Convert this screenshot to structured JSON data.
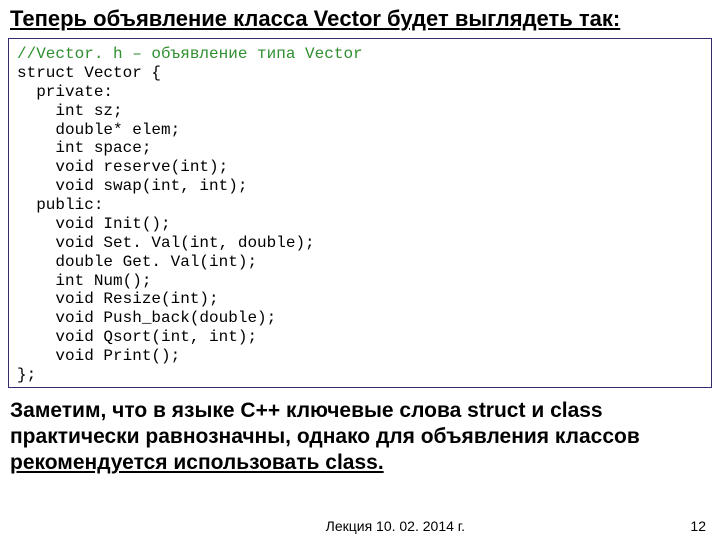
{
  "slide": {
    "heading": "Теперь объявление класса Vector будет выглядеть так:",
    "code": {
      "comment": "//Vector. h – объявление типа Vector",
      "lines": "struct Vector {\n  private:\n    int sz;\n    double* elem;\n    int space;\n    void reserve(int);\n    void swap(int, int);\n  public:\n    void Init();\n    void Set. Val(int, double);\n    double Get. Val(int);\n    int Num();\n    void Resize(int);\n    void Push_back(double);\n    void Qsort(int, int);\n    void Print();\n};"
    },
    "note_prefix": "Заметим, что в языке С++ ключевые слова struct и class практически равнозначны, однако для объявления классов ",
    "note_underlined": "рекомендуется использовать  class.",
    "footer_lecture": "Лекция 10. 02. 2014 г.",
    "footer_page": "12"
  }
}
